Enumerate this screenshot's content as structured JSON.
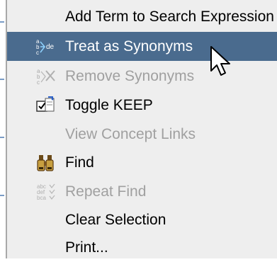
{
  "context_menu": {
    "items": [
      {
        "label": "Add Term to Search Expression",
        "enabled": true,
        "highlighted": false,
        "icon": "none"
      },
      {
        "label": "Treat as Synonyms",
        "enabled": true,
        "highlighted": true,
        "icon": "synonyms-abcde-icon"
      },
      {
        "label": "Remove Synonyms",
        "enabled": false,
        "highlighted": false,
        "icon": "remove-synonyms-icon"
      },
      {
        "label": "Toggle KEEP",
        "enabled": true,
        "highlighted": false,
        "icon": "toggle-keep-icon"
      },
      {
        "label": "View Concept Links",
        "enabled": false,
        "highlighted": false,
        "icon": "none"
      },
      {
        "label": "Find",
        "enabled": true,
        "highlighted": false,
        "icon": "binoculars-icon"
      },
      {
        "label": "Repeat Find",
        "enabled": false,
        "highlighted": false,
        "icon": "repeat-find-icon"
      },
      {
        "label": "Clear Selection",
        "enabled": true,
        "highlighted": false,
        "icon": "none"
      },
      {
        "label": "Print...",
        "enabled": true,
        "highlighted": false,
        "icon": "none"
      }
    ]
  },
  "colors": {
    "menu_background": "#eeeeee",
    "highlight": "#4a6b8e",
    "disabled_text": "#a0a0a0"
  }
}
